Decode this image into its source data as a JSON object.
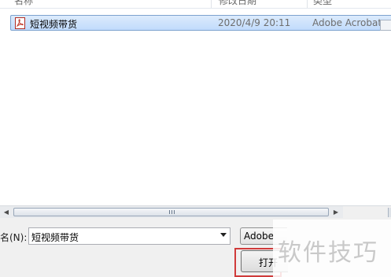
{
  "columns": {
    "name": "名称",
    "modified": "修改日期",
    "type": "类型"
  },
  "files": [
    {
      "name": "短视频带货",
      "modified": "2020/4/9 20:11",
      "type": "Adobe Acrobat",
      "icon": "pdf-file-icon",
      "selected": true
    }
  ],
  "scrollbar": {
    "left_arrow": "◀",
    "right_arrow": "▶"
  },
  "filename": {
    "label": "名(N):",
    "value": "短视频带货"
  },
  "filetype": {
    "value": "Adobe"
  },
  "buttons": {
    "open": "打开"
  },
  "watermark": "软件技巧",
  "colors": {
    "selection_fill": "#c1dbfc",
    "selection_border": "#7da2ce",
    "highlight_box": "#d03b3b"
  }
}
